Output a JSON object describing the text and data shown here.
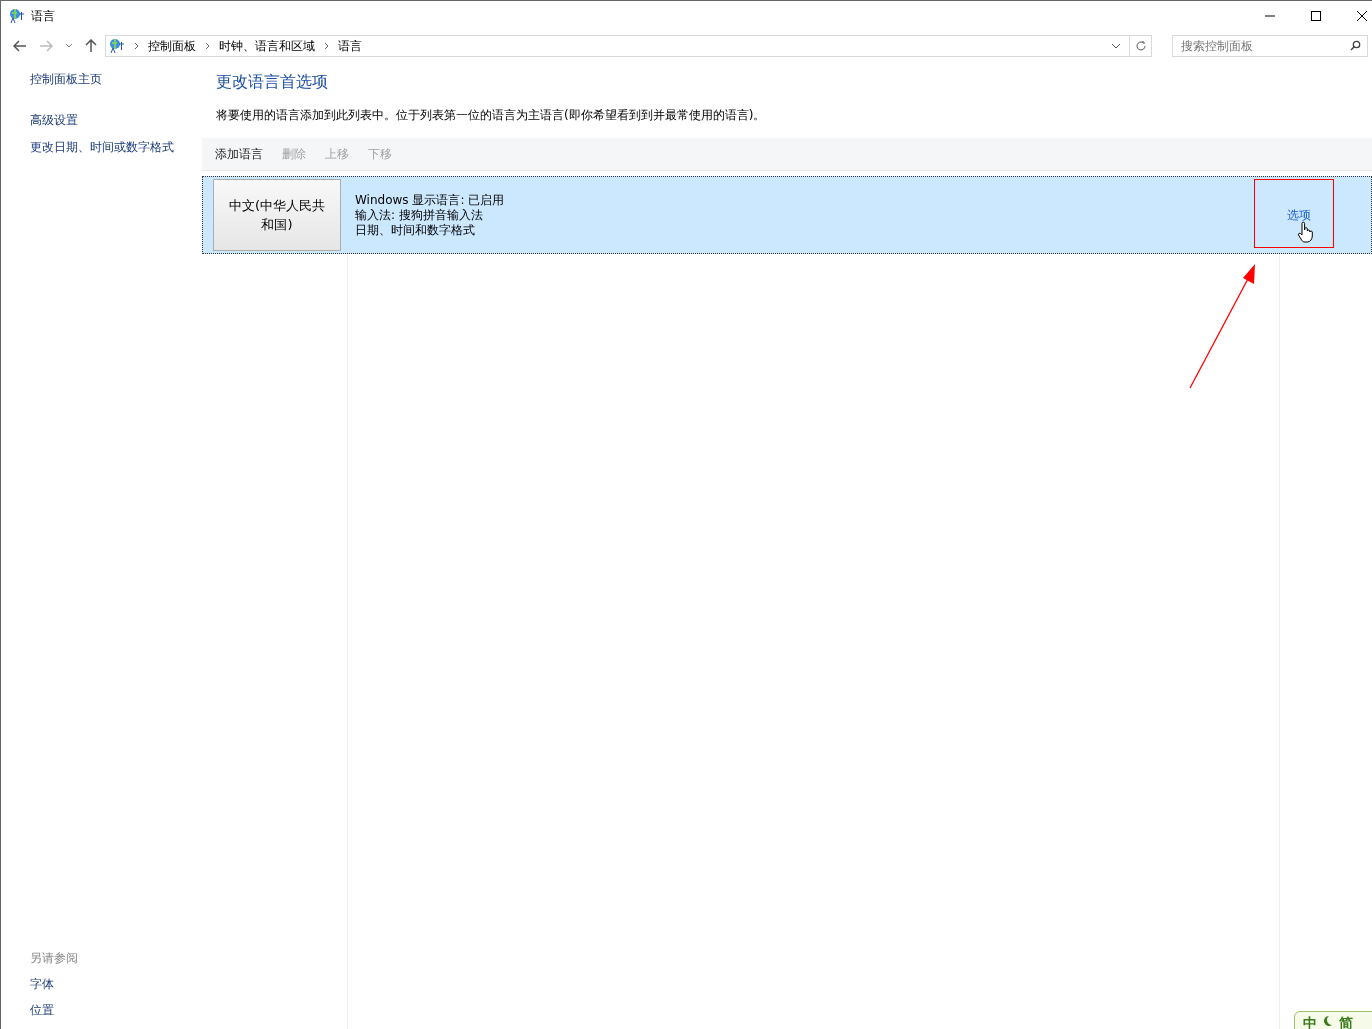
{
  "window": {
    "title": "语言"
  },
  "address_bar": {
    "breadcrumbs": [
      "控制面板",
      "时钟、语言和区域",
      "语言"
    ]
  },
  "search": {
    "placeholder": "搜索控制面板"
  },
  "sidebar": {
    "items": [
      {
        "label": "控制面板主页"
      },
      {
        "label": "高级设置"
      },
      {
        "label": "更改日期、时间或数字格式"
      }
    ],
    "see_also": {
      "heading": "另请参阅",
      "items": [
        "字体",
        "位置"
      ]
    }
  },
  "content": {
    "title": "更改语言首选项",
    "description": "将要使用的语言添加到此列表中。位于列表第一位的语言为主语言(即你希望看到到并最常使用的语言)。",
    "toolbar": [
      {
        "label": "添加语言",
        "disabled": false
      },
      {
        "label": "删除",
        "disabled": true
      },
      {
        "label": "上移",
        "disabled": true
      },
      {
        "label": "下移",
        "disabled": true
      }
    ],
    "languages": [
      {
        "name": "中文(中华人民共和国)",
        "details": [
          "Windows 显示语言: 已启用",
          "输入法: 搜狗拼音输入法",
          "日期、时间和数字格式"
        ],
        "options_link": "选项",
        "selected": true
      }
    ]
  },
  "ime_toolbar": {
    "labels": [
      "中",
      "简"
    ]
  }
}
